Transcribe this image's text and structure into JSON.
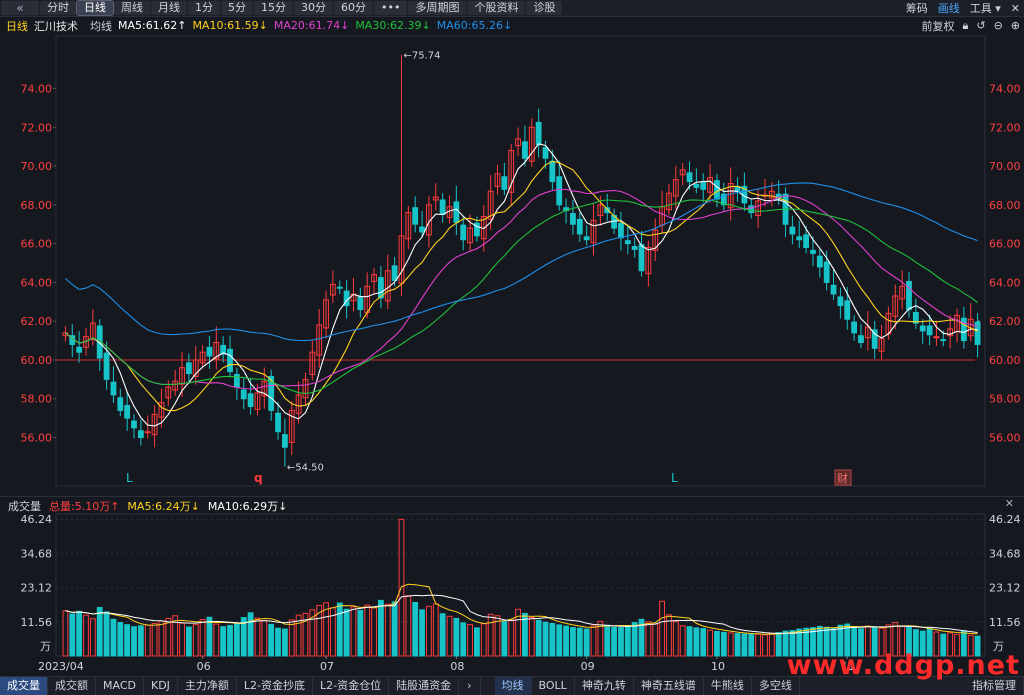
{
  "toolbar": {
    "back_icon": "double-left-chevron-icon",
    "items": [
      "分时",
      "日线",
      "周线",
      "月线",
      "1分",
      "5分",
      "15分",
      "30分",
      "60分",
      "•••",
      "多周期图",
      "个股资料",
      "诊股"
    ],
    "active_index": 1,
    "right": [
      "筹码",
      "画线",
      "工具"
    ]
  },
  "ma_bar": {
    "period": "日线",
    "stock": "汇川技术",
    "avg": "均线",
    "ma5": "MA5:61.62↑",
    "ma10": "MA10:61.59↓",
    "ma20": "MA20:61.74↓",
    "ma30": "MA30:62.39↓",
    "ma60": "MA60:65.26↓",
    "fq": "前复权"
  },
  "colors": {
    "up": "#ff3b3b",
    "down": "#17c5c9",
    "ma5": "#ffffff",
    "ma10": "#ffd21f",
    "ma20": "#e040d0",
    "ma30": "#21c03a",
    "ma60": "#1e8fe8",
    "text_red": "#ff4040"
  },
  "price_axis": {
    "ticks": [
      "74.00",
      "72.00",
      "70.00",
      "68.00",
      "66.00",
      "64.00",
      "62.00",
      "60.00",
      "58.00",
      "56.00"
    ]
  },
  "annotations": {
    "high": "←75.74",
    "low": "←54.50",
    "marker_q": "q",
    "marker_L1": "L",
    "marker_L2": "L",
    "marker_cai": "财"
  },
  "volume_bar": {
    "label": "成交量",
    "total": "总量:5.10万↑",
    "ma5": "MA5:6.24万↓",
    "ma10": "MA10:6.29万↓"
  },
  "volume_axis": {
    "ticks": [
      "46.24",
      "34.68",
      "23.12",
      "11.56"
    ],
    "unit": "万"
  },
  "date_axis": [
    "2023/04",
    "06",
    "07",
    "08",
    "09",
    "10",
    "11"
  ],
  "bottom_tabs": [
    "成交量",
    "成交额",
    "MACD",
    "KDJ",
    "主力净额",
    "L2-资金抄底",
    "L2-资金仓位",
    "陆股通资金",
    "均线",
    "BOLL",
    "神奇九转",
    "神奇五线谱",
    "牛熊线",
    "多空线",
    "指标管理"
  ],
  "watermark": "www.ddgp.net",
  "chart_data": {
    "type": "candlestick",
    "ylim": [
      53.5,
      76.5
    ],
    "high_mark": 75.74,
    "low_mark": 54.5,
    "support_line": 60.0,
    "closes": [
      61.4,
      60.8,
      60.4,
      61.2,
      61.9,
      60.1,
      59.0,
      58.2,
      57.4,
      57.0,
      56.5,
      56.0,
      56.3,
      57.2,
      57.8,
      58.6,
      58.9,
      59.6,
      59.3,
      60.0,
      60.4,
      60.2,
      60.9,
      60.3,
      59.4,
      58.6,
      58.0,
      57.6,
      58.3,
      58.9,
      57.4,
      56.3,
      55.5,
      57.4,
      58.2,
      59.0,
      60.4,
      61.8,
      63.1,
      63.9,
      63.7,
      62.8,
      63.4,
      62.6,
      63.8,
      64.4,
      63.2,
      64.6,
      64.1,
      66.4,
      67.6,
      67.0,
      66.6,
      68.0,
      68.4,
      67.5,
      67.9,
      67.1,
      66.2,
      66.8,
      66.4,
      67.4,
      68.7,
      69.6,
      68.8,
      70.8,
      71.4,
      70.4,
      72.0,
      71.1,
      70.4,
      69.2,
      68.0,
      67.7,
      67.0,
      66.5,
      66.2,
      67.2,
      68.0,
      67.6,
      66.8,
      66.3,
      66.0,
      65.7,
      64.6,
      65.8,
      66.7,
      67.9,
      68.6,
      69.3,
      69.8,
      69.2,
      68.9,
      68.8,
      69.4,
      68.3,
      68.0,
      69.1,
      68.7,
      68.1,
      67.6,
      68.2,
      68.5,
      68.7,
      68.3,
      67.0,
      66.5,
      66.2,
      65.8,
      65.5,
      64.8,
      64.0,
      63.4,
      62.8,
      62.1,
      61.4,
      60.9,
      61.7,
      60.6,
      61.1,
      62.4,
      63.3,
      63.8,
      62.6,
      61.9,
      61.5,
      61.3,
      61.2,
      61.0,
      61.6,
      62.3,
      61.0,
      62.1,
      60.8
    ],
    "volumes": [
      15.3,
      14.2,
      15.1,
      13.8,
      12.6,
      16.4,
      14.9,
      12.4,
      11.3,
      10.6,
      9.9,
      10.2,
      10.4,
      11.0,
      11.8,
      12.7,
      13.6,
      11.1,
      9.8,
      10.6,
      12.3,
      13.1,
      10.8,
      9.9,
      10.3,
      11.0,
      13.0,
      14.6,
      12.8,
      11.9,
      10.7,
      9.4,
      9.1,
      12.2,
      13.8,
      14.4,
      15.6,
      17.1,
      18.0,
      16.3,
      17.9,
      15.8,
      16.6,
      15.4,
      17.2,
      16.3,
      18.8,
      17.5,
      18.3,
      46.2,
      20.4,
      18.1,
      15.6,
      16.8,
      17.6,
      14.3,
      13.4,
      12.7,
      11.2,
      10.6,
      9.5,
      10.9,
      14.1,
      13.6,
      11.6,
      12.2,
      15.8,
      14.4,
      13.0,
      12.1,
      11.4,
      11.0,
      10.5,
      10.1,
      9.6,
      9.4,
      9.1,
      10.2,
      11.7,
      10.4,
      9.7,
      9.6,
      10.1,
      11.3,
      12.4,
      11.6,
      10.8,
      18.5,
      13.9,
      11.6,
      10.2,
      9.9,
      9.5,
      9.3,
      8.7,
      8.3,
      8.0,
      7.8,
      7.6,
      7.4,
      7.3,
      7.4,
      7.2,
      7.6,
      7.9,
      8.4,
      8.6,
      9.1,
      9.4,
      9.6,
      10.0,
      9.7,
      9.2,
      10.4,
      10.8,
      9.8,
      9.2,
      10.1,
      9.6,
      9.4,
      10.5,
      11.3,
      10.1,
      9.8,
      8.9,
      8.4,
      9.2,
      8.1,
      7.4,
      7.8,
      7.3,
      8.5,
      7.0,
      6.7
    ]
  }
}
